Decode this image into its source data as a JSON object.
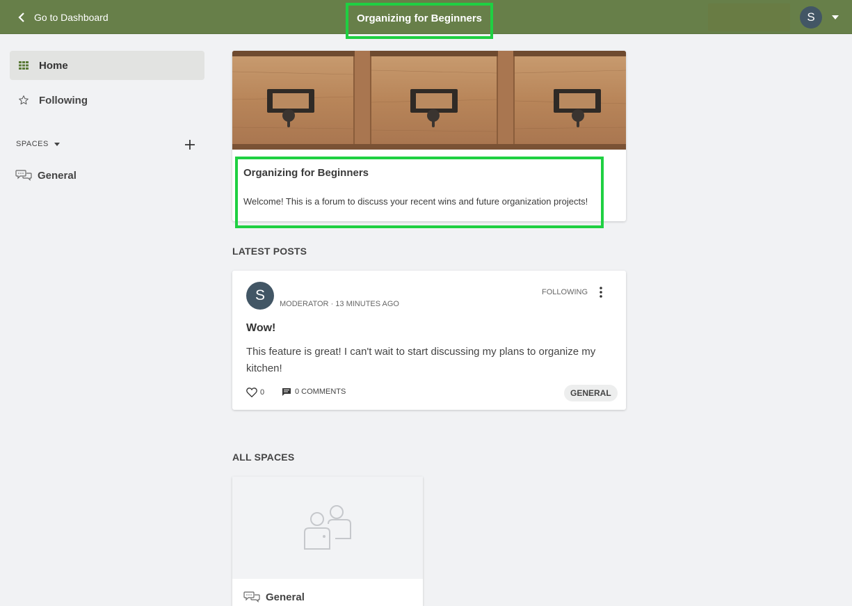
{
  "topbar": {
    "back_label": "Go to Dashboard",
    "title": "Organizing for Beginners",
    "user_initial": "S"
  },
  "sidebar": {
    "items": [
      {
        "label": "Home",
        "icon": "grid-icon",
        "active": true
      },
      {
        "label": "Following",
        "icon": "star-icon",
        "active": false
      }
    ],
    "spaces_heading": "SPACES",
    "spaces": [
      {
        "label": "General",
        "icon": "chat-bubbles-icon"
      }
    ]
  },
  "hero": {
    "title": "Organizing for Beginners",
    "description": "Welcome! This is a forum to discuss your recent wins and future organization projects!"
  },
  "latest_posts": {
    "heading": "LATEST POSTS",
    "posts": [
      {
        "author_initial": "S",
        "role": "MODERATOR",
        "time": "13 MINUTES AGO",
        "follow_label": "FOLLOWING",
        "title": "Wow!",
        "body": "This feature is great! I can't wait to start discussing my plans to organize my kitchen!",
        "likes": "0",
        "comments": "0 COMMENTS",
        "tag": "GENERAL"
      }
    ]
  },
  "all_spaces": {
    "heading": "ALL SPACES",
    "spaces": [
      {
        "label": "General"
      }
    ]
  },
  "colors": {
    "topbar": "#677f49",
    "highlight": "#1fd042",
    "avatar": "#425665",
    "background": "#f1f2f4"
  }
}
